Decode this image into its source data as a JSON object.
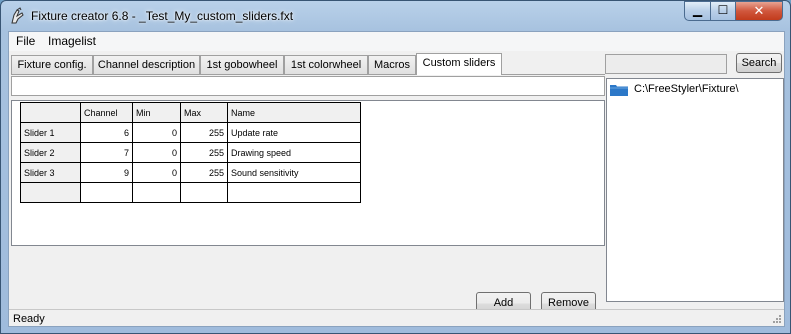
{
  "window": {
    "title": "Fixture creator 6.8 - _Test_My_custom_sliders.fxt"
  },
  "icons": {
    "app": "hand-pointer-icon",
    "minimize": "minimize-icon",
    "maximize": "maximize-icon",
    "close": "close-icon",
    "folder": "folder-icon",
    "resize": "resize-grip-icon"
  },
  "colors": {
    "close_button": "#c7442a",
    "titlebar": "#b9d1ea",
    "folder": "#2c78c8"
  },
  "caption": {
    "min_glyph": "▁",
    "max_glyph": "☐",
    "close_glyph": "✕"
  },
  "menu": {
    "file": "File",
    "imagelist": "Imagelist"
  },
  "tabs": [
    {
      "label": "Fixture config."
    },
    {
      "label": "Channel description"
    },
    {
      "label": "1st gobowheel"
    },
    {
      "label": "1st colorwheel"
    },
    {
      "label": "Macros"
    },
    {
      "label": "Custom sliders",
      "active": true
    }
  ],
  "grid": {
    "headers": [
      "Channel",
      "Min",
      "Max",
      "Name"
    ],
    "rows": [
      {
        "label": "Slider 1",
        "channel": "6",
        "min": "0",
        "max": "255",
        "name": "Update rate"
      },
      {
        "label": "Slider 2",
        "channel": "7",
        "min": "0",
        "max": "255",
        "name": "Drawing speed"
      },
      {
        "label": "Slider 3",
        "channel": "9",
        "min": "0",
        "max": "255",
        "name": "Sound sensitivity"
      }
    ]
  },
  "buttons": {
    "add": "Add",
    "remove": "Remove",
    "search": "Search"
  },
  "search": {
    "value": ""
  },
  "tree": {
    "root": "C:\\FreeStyler\\Fixture\\"
  },
  "status": {
    "text": "Ready"
  }
}
